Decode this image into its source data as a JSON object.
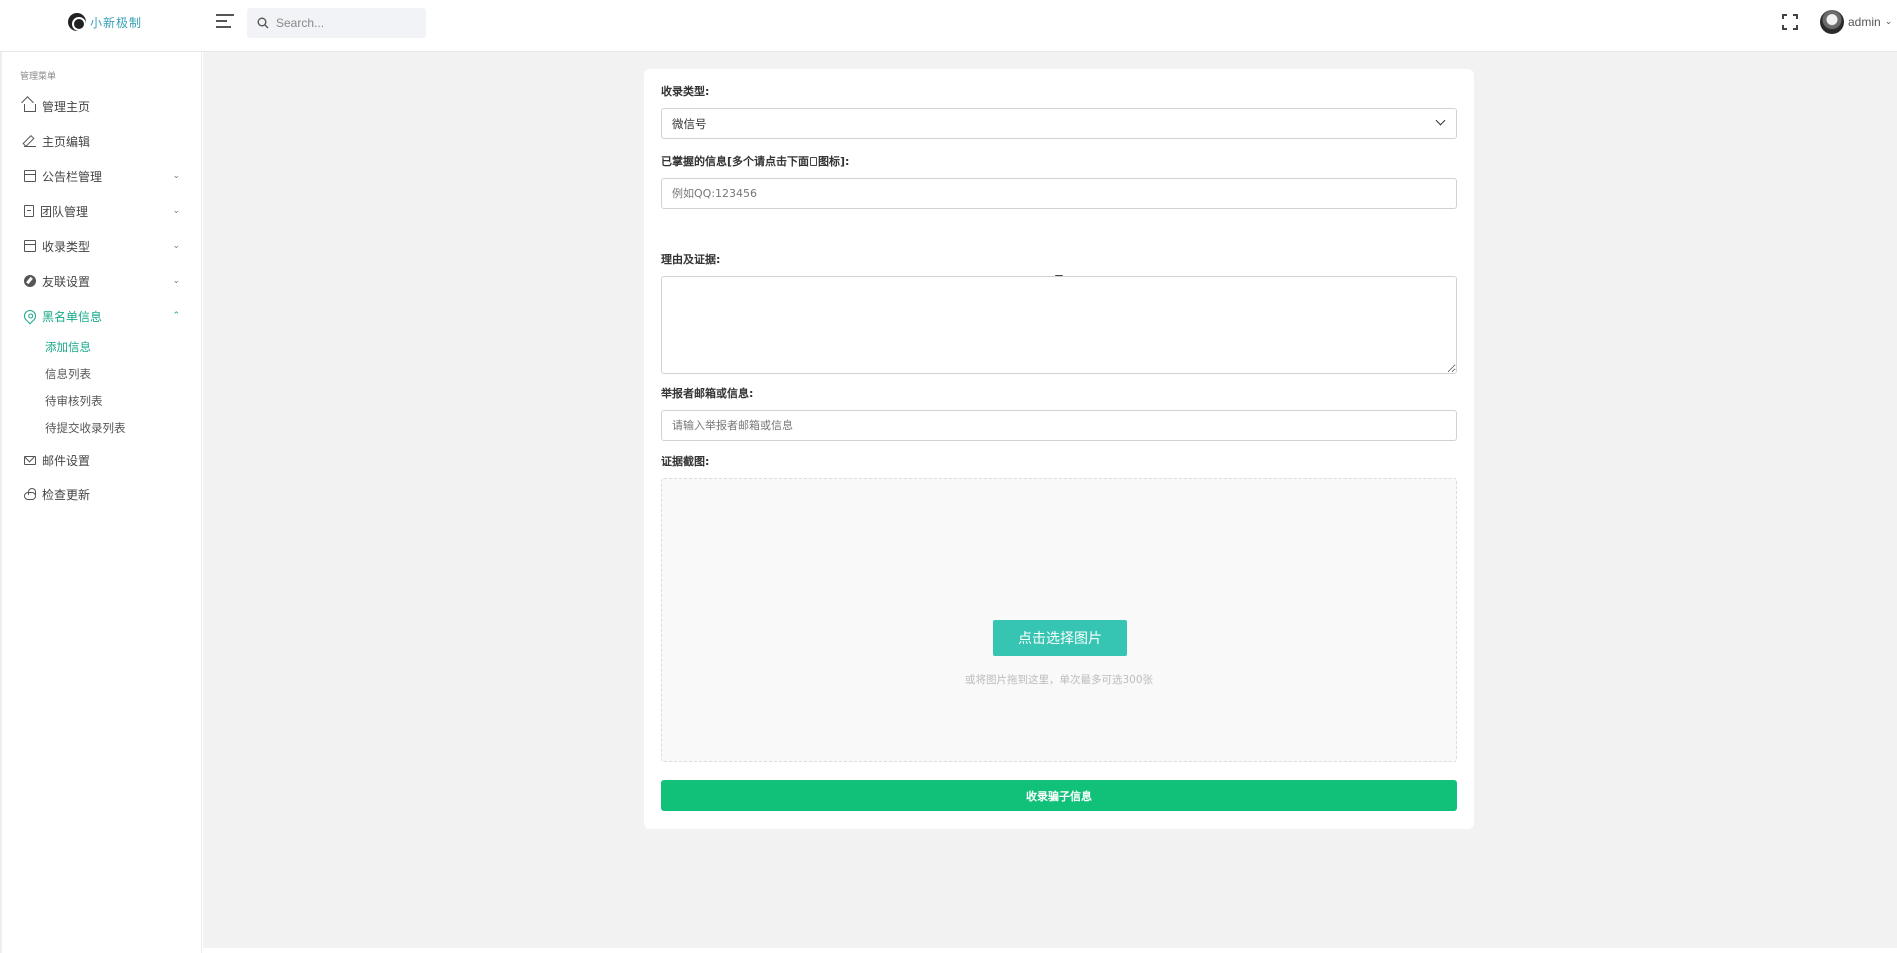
{
  "header": {
    "brand_name": "小新极制",
    "search_placeholder": "Search...",
    "user_name": "admin"
  },
  "sidebar": {
    "title": "管理菜单",
    "items": [
      {
        "label": "管理主页",
        "icon": "home-icon"
      },
      {
        "label": "主页编辑",
        "icon": "edit-icon"
      },
      {
        "label": "公告栏管理",
        "icon": "layout-icon",
        "expandable": true
      },
      {
        "label": "团队管理",
        "icon": "document-icon",
        "expandable": true
      },
      {
        "label": "收录类型",
        "icon": "calendar-icon",
        "expandable": true
      },
      {
        "label": "友联设置",
        "icon": "compass-icon",
        "expandable": true
      },
      {
        "label": "黑名单信息",
        "icon": "map-pin-icon",
        "expandable": true,
        "expanded": true,
        "active": true
      },
      {
        "label": "邮件设置",
        "icon": "mail-icon"
      },
      {
        "label": "检查更新",
        "icon": "cloud-icon"
      }
    ],
    "subitems": [
      {
        "label": "添加信息",
        "active": true
      },
      {
        "label": "信息列表"
      },
      {
        "label": "待审核列表"
      },
      {
        "label": "待提交收录列表"
      }
    ]
  },
  "form": {
    "type_label": "收录类型:",
    "type_value": "微信号",
    "info_label_prefix": "已掌握的信息[多个请点击下面",
    "info_label_suffix": "图标]:",
    "info_placeholder": "例如QQ:123456",
    "reason_label": "理由及证据:",
    "reporter_label": "举报者邮箱或信息:",
    "reporter_placeholder": "请输入举报者邮箱或信息",
    "screenshot_label": "证据截图:",
    "pick_button": "点击选择图片",
    "drop_hint": "或将图片拖到这里，单次最多可选300张",
    "submit_button": "收录骗子信息"
  },
  "colors": {
    "accent": "#17a98a",
    "pick_button": "#36c5b3",
    "submit_button": "#11c17a"
  }
}
